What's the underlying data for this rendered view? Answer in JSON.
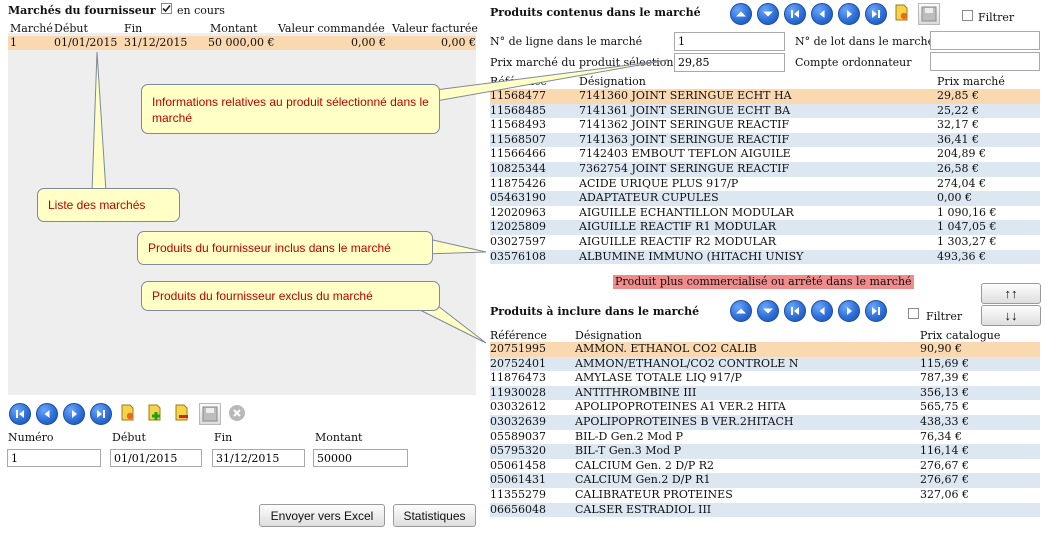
{
  "markets_panel": {
    "title": "Marchés du fournisseur",
    "en_cours_label": "en cours",
    "en_cours_checked": true,
    "columns": [
      "Marché",
      "Début",
      "Fin",
      "Montant",
      "Valeur commandée",
      "Valeur facturée"
    ],
    "rows": [
      {
        "marche": "1",
        "debut": "01/01/2015",
        "fin": "31/12/2015",
        "montant": "50 000,00 €",
        "commandee": "0,00 €",
        "facturee": "0,00 €"
      }
    ]
  },
  "market_form": {
    "labels": {
      "numero": "Numéro",
      "debut": "Début",
      "fin": "Fin",
      "montant": "Montant"
    },
    "values": {
      "numero": "1",
      "debut": "01/01/2015",
      "fin": "31/12/2015",
      "montant": "50000"
    }
  },
  "bottom_buttons": {
    "excel": "Envoyer vers Excel",
    "stats": "Statistiques"
  },
  "products_in_market": {
    "title": "Produits contenus dans le marché",
    "filter_label": "Filtrer",
    "fields": {
      "line_label": "N° de ligne dans le marché",
      "line_value": "1",
      "lot_label": "N° de lot dans le marché",
      "lot_value": "",
      "price_label": "Prix marché du produit sélectionné",
      "price_value": "29,85",
      "account_label": "Compte ordonnateur",
      "account_value": ""
    },
    "columns": [
      "Référence",
      "Désignation",
      "Prix marché"
    ],
    "rows": [
      {
        "ref": "11568477",
        "des": "7141360 JOINT SERINGUE ECHT HA",
        "price": "29,85 €"
      },
      {
        "ref": "11568485",
        "des": "7141361 JOINT SERINGUE ECHT BA",
        "price": "25,22 €"
      },
      {
        "ref": "11568493",
        "des": "7141362 JOINT SERINGUE REACTIF",
        "price": "32,17 €"
      },
      {
        "ref": "11568507",
        "des": "7141363 JOINT SERINGUE REACTIF",
        "price": "36,41 €"
      },
      {
        "ref": "11566466",
        "des": "7142403 EMBOUT TEFLON AIGUILE",
        "price": "204,89 €"
      },
      {
        "ref": "10825344",
        "des": "7362754 JOINT SERINGUE REACTIF",
        "price": "26,58 €"
      },
      {
        "ref": "11875426",
        "des": "ACIDE URIQUE PLUS 917/P",
        "price": "274,04 €"
      },
      {
        "ref": "05463190",
        "des": "ADAPTATEUR CUPULES",
        "price": "0,00 €"
      },
      {
        "ref": "12020963",
        "des": "AIGUILLE ECHANTILLON MODULAR",
        "price": "1 090,16 €"
      },
      {
        "ref": "12025809",
        "des": "AIGUILLE REACTIF R1 MODULAR",
        "price": "1 047,05 €"
      },
      {
        "ref": "03027597",
        "des": "AIGUILLE REACTIF R2 MODULAR",
        "price": "1 303,27 €"
      },
      {
        "ref": "03576108",
        "des": "ALBUMINE IMMUNO (HITACHI UNISY",
        "price": "493,36 €"
      }
    ]
  },
  "warning_badge": "Produit plus commercialisé ou arrêté dans le marché",
  "move_buttons": {
    "up": "↑↑",
    "down": "↓↓"
  },
  "products_to_include": {
    "title": "Produits à inclure dans le marché",
    "filter_label": "Filtrer",
    "columns": [
      "Référence",
      "Désignation",
      "Prix catalogue"
    ],
    "rows": [
      {
        "ref": "20751995",
        "des": "AMMON. ETHANOL CO2 CALIB",
        "price": "90,90 €"
      },
      {
        "ref": "20752401",
        "des": "AMMON/ETHANOL/CO2 CONTROLE N",
        "price": "115,69 €"
      },
      {
        "ref": "11876473",
        "des": "AMYLASE TOTALE LIQ 917/P",
        "price": "787,39 €"
      },
      {
        "ref": "11930028",
        "des": "ANTITHROMBINE III",
        "price": "356,13 €"
      },
      {
        "ref": "03032612",
        "des": "APOLIPOPROTEINES A1 VER.2 HITA",
        "price": "565,75 €"
      },
      {
        "ref": "03032639",
        "des": "APOLIPOPROTEINES B VER.2HITACH",
        "price": "438,33 €"
      },
      {
        "ref": "05589037",
        "des": "BIL-D Gen.2 Mod P",
        "price": "76,34 €"
      },
      {
        "ref": "05795320",
        "des": "BIL-T Gen.3 Mod P",
        "price": "116,14 €"
      },
      {
        "ref": "05061458",
        "des": "CALCIUM Gen. 2 D/P R2",
        "price": "276,67 €"
      },
      {
        "ref": "05061431",
        "des": "CALCIUM Gen.2 D/P R1",
        "price": "276,67 €"
      },
      {
        "ref": "11355279",
        "des": "CALIBRATEUR PROTEINES",
        "price": "327,06 €"
      },
      {
        "ref": "06656048",
        "des": "CALSER ESTRADIOL III",
        "price": ""
      }
    ]
  },
  "callouts": {
    "info_produit": "Informations relatives au produit sélectionné dans le marché",
    "liste_marches": "Liste des marchés",
    "inclus": "Produits du fournisseur inclus dans le marché",
    "exclus": "Produits du fournisseur exclus du marché"
  },
  "colors": {
    "selected_row": "#fbd9b0",
    "alt_row": "#dce7f2",
    "callout_bg": "#ffffc6",
    "callout_text": "#c00000",
    "nav_blue": "#2d6fd8"
  }
}
